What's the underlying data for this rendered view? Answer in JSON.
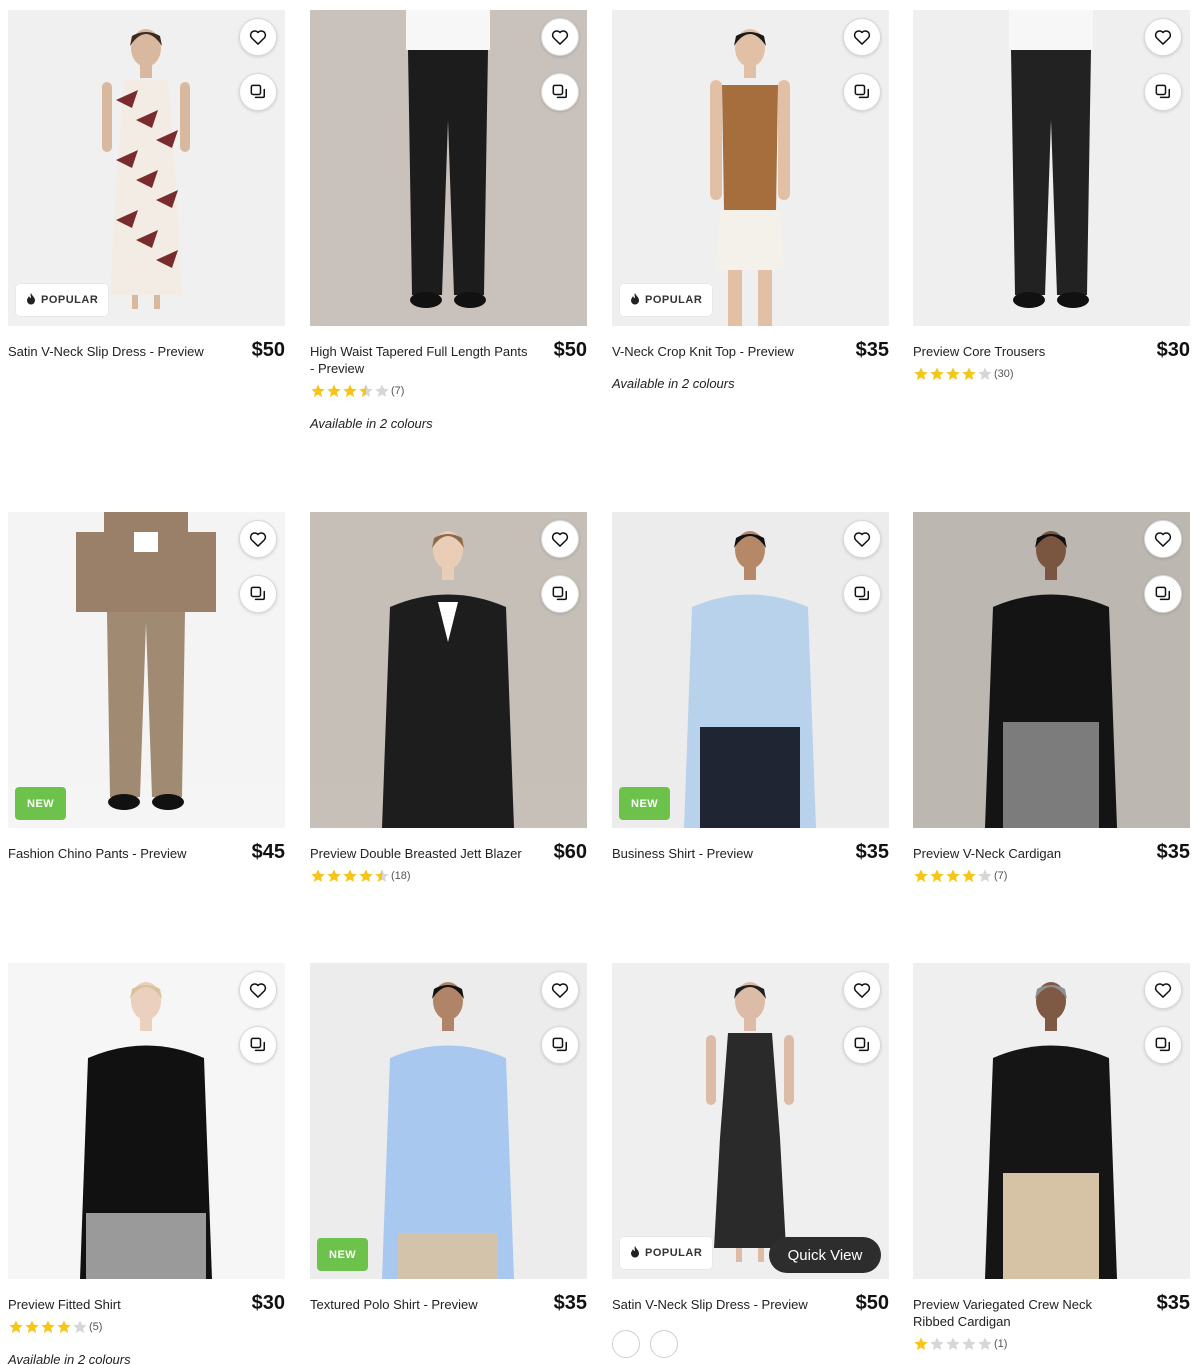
{
  "products": [
    {
      "title": "Satin V-Neck Slip Dress - Preview",
      "price": "$50",
      "badge": "POPULAR",
      "badge_type": "popular",
      "rating": null,
      "review_count": "",
      "colours": "",
      "wishlist_icon": "heart-icon",
      "compare_icon": "compare-icon"
    },
    {
      "title": "High Waist Tapered Full Length Pants - Preview",
      "price": "$50",
      "badge": "",
      "badge_type": "",
      "rating": 3.5,
      "review_count": "(7)",
      "colours": "Available in 2 colours",
      "wishlist_icon": "heart-icon",
      "compare_icon": "compare-icon"
    },
    {
      "title": "V-Neck Crop Knit Top - Preview",
      "price": "$35",
      "badge": "POPULAR",
      "badge_type": "popular",
      "rating": null,
      "review_count": "",
      "colours": "Available in 2 colours",
      "wishlist_icon": "heart-icon",
      "compare_icon": "compare-icon"
    },
    {
      "title": "Preview Core Trousers",
      "price": "$30",
      "badge": "",
      "badge_type": "",
      "rating": 4,
      "review_count": "(30)",
      "colours": "",
      "wishlist_icon": "heart-icon",
      "compare_icon": "compare-icon"
    },
    {
      "title": "Fashion Chino Pants - Preview",
      "price": "$45",
      "badge": "NEW",
      "badge_type": "new",
      "rating": null,
      "review_count": "",
      "colours": "",
      "wishlist_icon": "heart-icon",
      "compare_icon": "compare-icon"
    },
    {
      "title": "Preview Double Breasted Jett Blazer",
      "price": "$60",
      "badge": "",
      "badge_type": "",
      "rating": 4.5,
      "review_count": "(18)",
      "colours": "",
      "wishlist_icon": "heart-icon",
      "compare_icon": "compare-icon"
    },
    {
      "title": "Business Shirt - Preview",
      "price": "$35",
      "badge": "NEW",
      "badge_type": "new",
      "rating": null,
      "review_count": "",
      "colours": "",
      "wishlist_icon": "heart-icon",
      "compare_icon": "compare-icon"
    },
    {
      "title": "Preview V-Neck Cardigan",
      "price": "$35",
      "badge": "",
      "badge_type": "",
      "rating": 4,
      "review_count": "(7)",
      "colours": "",
      "wishlist_icon": "heart-icon",
      "compare_icon": "compare-icon"
    },
    {
      "title": "Preview Fitted Shirt",
      "price": "$30",
      "badge": "",
      "badge_type": "",
      "rating": 4,
      "review_count": "(5)",
      "colours": "Available in 2 colours",
      "wishlist_icon": "heart-icon",
      "compare_icon": "compare-icon"
    },
    {
      "title": "Textured Polo Shirt - Preview",
      "price": "$35",
      "badge": "NEW",
      "badge_type": "new",
      "rating": null,
      "review_count": "",
      "colours": "",
      "wishlist_icon": "heart-icon",
      "compare_icon": "compare-icon"
    },
    {
      "title": "Satin V-Neck Slip Dress - Preview",
      "price": "$50",
      "badge": "POPULAR",
      "badge_type": "popular",
      "rating": null,
      "review_count": "",
      "colours": "",
      "quick_view": "Quick View",
      "swatches": 2,
      "wishlist_icon": "heart-icon",
      "compare_icon": "compare-icon"
    },
    {
      "title": "Preview Variegated Crew Neck Ribbed Cardigan",
      "price": "$35",
      "badge": "",
      "badge_type": "",
      "rating": 1,
      "review_count": "(1)",
      "colours": "",
      "wishlist_icon": "heart-icon",
      "compare_icon": "compare-icon"
    }
  ],
  "colors": {
    "star": "#f5c518",
    "star_empty": "#d6d6d6",
    "new_badge": "#6cc24a",
    "quick_view_bg": "#2d2d2d"
  }
}
